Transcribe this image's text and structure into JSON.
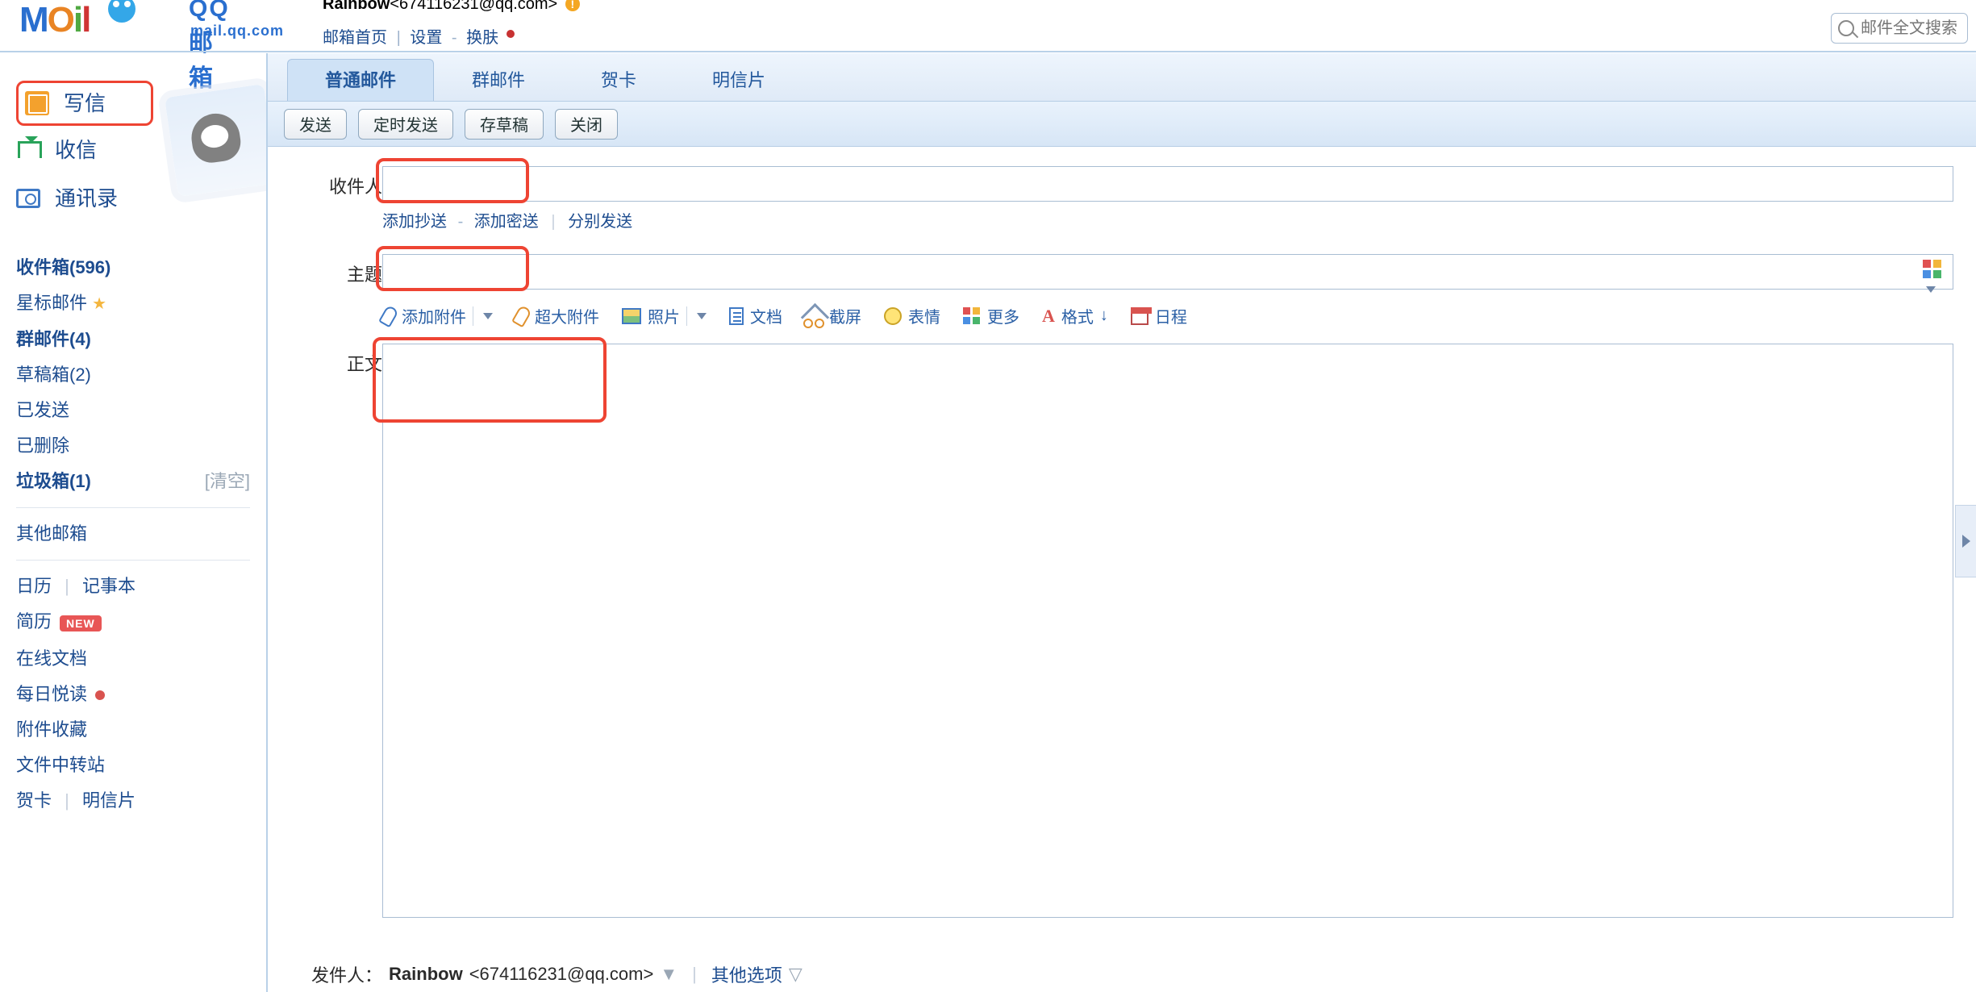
{
  "header": {
    "brand_cn": "QQ邮箱",
    "brand_en": "mail.qq.com",
    "user_name": "Rainbow",
    "user_email": "<674116231@qq.com>",
    "warn": "!",
    "nav_home": "邮箱首页",
    "nav_settings": "设置",
    "nav_skin": "换肤",
    "search_placeholder": "邮件全文搜索"
  },
  "sidebar": {
    "compose": "写信",
    "inbox_action": "收信",
    "contacts": "通讯录",
    "folders": {
      "inbox": "收件箱(596)",
      "starred": "星标邮件",
      "group": "群邮件(4)",
      "drafts": "草稿箱(2)",
      "sent": "已发送",
      "deleted": "已删除",
      "spam": "垃圾箱(1)",
      "spam_clear": "[清空]",
      "other_mailboxes": "其他邮箱",
      "calendar": "日历",
      "notes": "记事本",
      "resume": "简历",
      "resume_badge": "NEW",
      "online_doc": "在线文档",
      "daily_read": "每日悦读",
      "attachments": "附件收藏",
      "file_transit": "文件中转站",
      "greeting": "贺卡",
      "postcard": "明信片"
    }
  },
  "compose": {
    "tabs": {
      "normal": "普通邮件",
      "group": "群邮件",
      "greeting": "贺卡",
      "postcard": "明信片"
    },
    "buttons": {
      "send": "发送",
      "schedule": "定时发送",
      "save_draft": "存草稿",
      "close": "关闭"
    },
    "labels": {
      "to": "收件人",
      "subject": "主题",
      "body": "正文",
      "add_cc": "添加抄送",
      "add_bcc": "添加密送",
      "send_separately": "分别发送"
    },
    "editbar": {
      "attach": "添加附件",
      "big_attach": "超大附件",
      "photo": "照片",
      "doc": "文档",
      "screenshot": "截屏",
      "emoji": "表情",
      "more": "更多",
      "format": "格式",
      "schedule_icon": "日程"
    },
    "footer": {
      "sender_label": "发件人：",
      "sender_name": "Rainbow",
      "sender_email": "<674116231@qq.com>",
      "other_options": "其他选项"
    }
  }
}
